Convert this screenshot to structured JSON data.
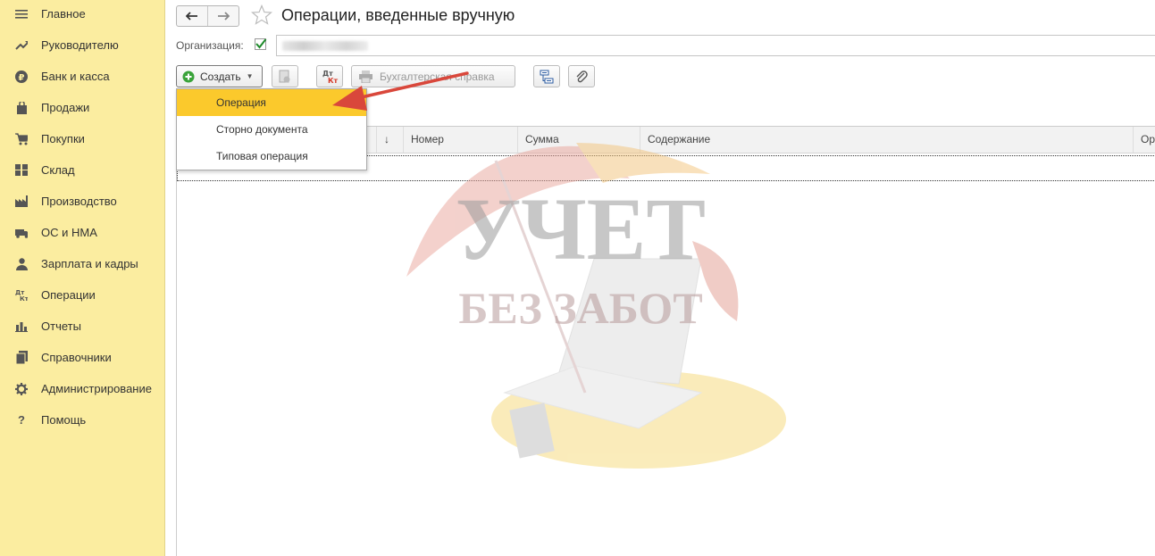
{
  "sidebar": {
    "items": [
      {
        "label": "Главное",
        "icon": "menu-icon"
      },
      {
        "label": "Руководителю",
        "icon": "trend-icon"
      },
      {
        "label": "Банк и касса",
        "icon": "ruble-icon"
      },
      {
        "label": "Продажи",
        "icon": "bag-icon"
      },
      {
        "label": "Покупки",
        "icon": "cart-icon"
      },
      {
        "label": "Склад",
        "icon": "warehouse-icon"
      },
      {
        "label": "Производство",
        "icon": "factory-icon"
      },
      {
        "label": "ОС и НМА",
        "icon": "truck-icon"
      },
      {
        "label": "Зарплата и кадры",
        "icon": "person-icon"
      },
      {
        "label": "Операции",
        "icon": "dt-kt-icon"
      },
      {
        "label": "Отчеты",
        "icon": "bar-chart-icon"
      },
      {
        "label": "Справочники",
        "icon": "books-icon"
      },
      {
        "label": "Администрирование",
        "icon": "gear-icon"
      },
      {
        "label": "Помощь",
        "icon": "help-icon"
      }
    ]
  },
  "header": {
    "title": "Операции, введенные вручную"
  },
  "filter": {
    "org_label": "Организация:"
  },
  "toolbar": {
    "create_label": "Создать",
    "print_label": "Бухгалтерская справка",
    "dtkt_top": "Дт",
    "dtkt_bottom": "Кт"
  },
  "dropdown": {
    "items": [
      "Операция",
      "Сторно документа",
      "Типовая операция"
    ],
    "selected": "Операция"
  },
  "table": {
    "columns": [
      "↓",
      "Номер",
      "Сумма",
      "Содержание",
      "Ор"
    ]
  },
  "watermark": {
    "line1": "УЧЕТ",
    "line2": "БЕЗ ЗАБОТ"
  },
  "colors": {
    "sidebar_bg": "#fbeda0",
    "selected_item": "#fbc92c",
    "arrow": "#d9473b",
    "create_icon": "#3aa33a"
  }
}
